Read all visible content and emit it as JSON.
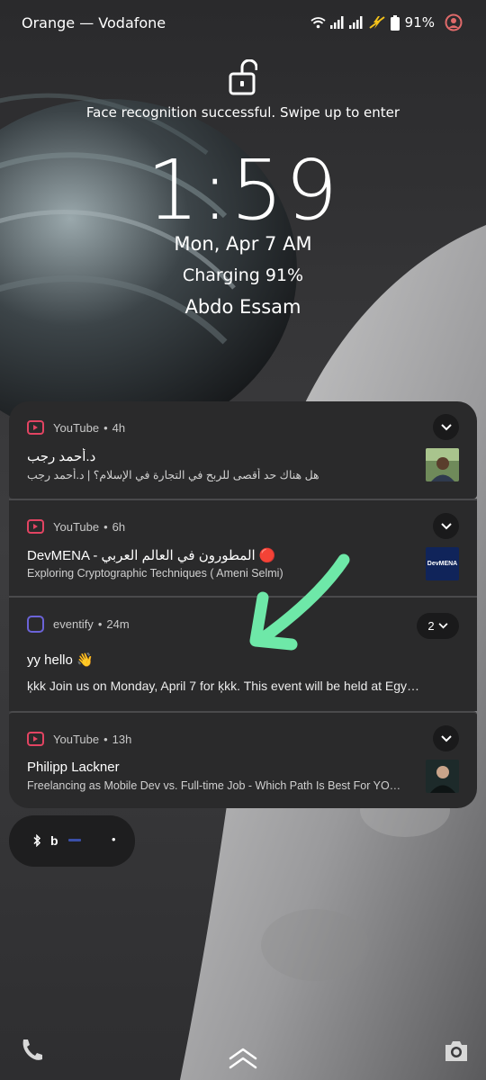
{
  "status_bar": {
    "carrier": "Orange — Vodafone",
    "battery_text": "91%",
    "icons": [
      "wifi-icon",
      "signal-icon",
      "signal-icon",
      "charging-bolt-icon",
      "battery-icon",
      "account-icon"
    ]
  },
  "lock": {
    "icon": "unlock-icon",
    "message": "Face recognition successful. Swipe up to enter",
    "time": "1:59",
    "date": "Mon, Apr 7  AM",
    "charging": "Charging 91%",
    "owner": "Abdo Essam"
  },
  "notifications": [
    {
      "app": "YouTube",
      "dot": "•",
      "age": "4h",
      "title": "د.أحمد رجب",
      "text": "هل هناك حد أقصى للربح في التجارة في الإسلام؟ | د.أحمد رجب",
      "progress": 1.0
    },
    {
      "app": "YouTube",
      "dot": "•",
      "age": "6h",
      "title": "DevMENA - المطورون في العالم العربي 🔴",
      "text": "Exploring Cryptographic Techniques ( Ameni Selmi)",
      "thumb_text": "DevMENA",
      "progress": 0.2
    },
    {
      "app": "eventify",
      "dot": "•",
      "age": "24m",
      "count": "2",
      "title": "yy hello 👋",
      "text": "ķkk Join us on Monday, April 7 for ķkk. This event will be held at Egy…",
      "progress": 0.16
    },
    {
      "app": "YouTube",
      "dot": "•",
      "age": "13h",
      "title": "Philipp Lackner",
      "text": "Freelancing as Mobile Dev vs. Full-time Job - Which Path Is Best For YO…"
    }
  ],
  "mini_pill": {
    "b_letter": "b",
    "dot": "•"
  },
  "bottom": {
    "left_icon": "phone-icon",
    "center_icon": "swipe-up-chevron-icon",
    "right_icon": "camera-icon"
  },
  "colors": {
    "accent_youtube": "#e24462",
    "accent_eventify": "#6b63d8",
    "arrow": "#6ee8a8",
    "card_bg": "#2a2a2b"
  }
}
